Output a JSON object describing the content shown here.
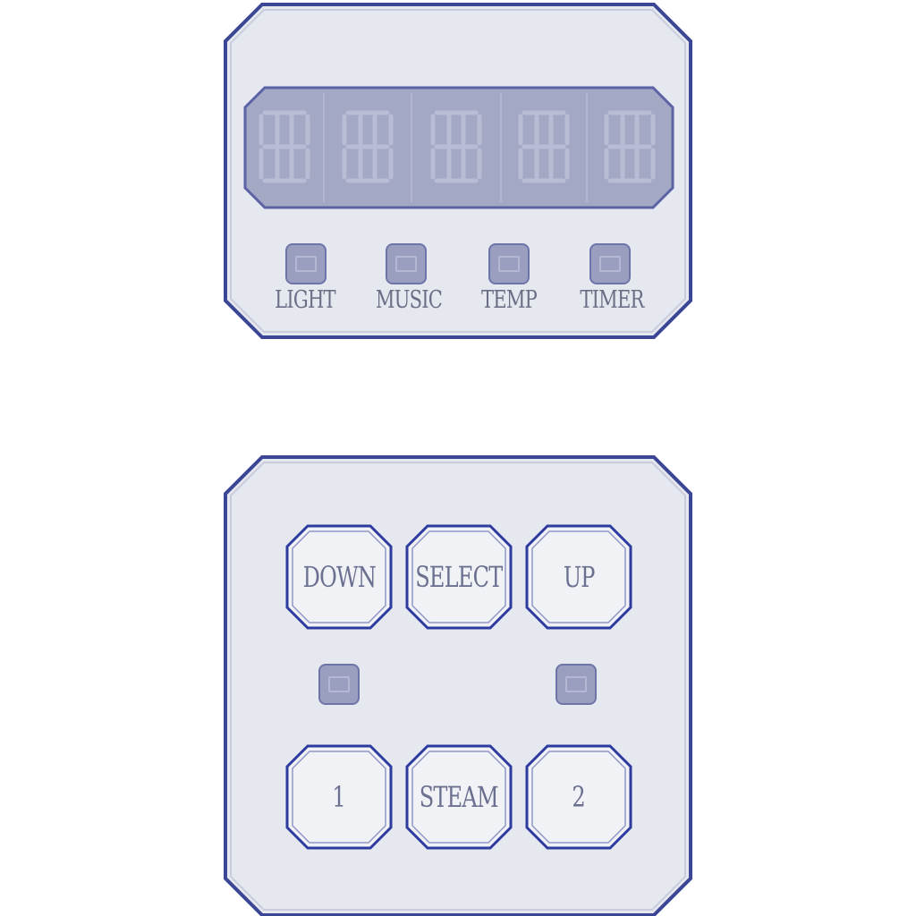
{
  "colors": {
    "panel_fill": "#e6e8f0",
    "panel_border": "#3b4695",
    "display_fill": "#a3a8c4",
    "display_border": "#5b63a5",
    "key_border": "#2d3a9e",
    "key_fill": "#f1f2f6",
    "label": "#6a6f86"
  },
  "indicators": [
    {
      "label": "LIGHT"
    },
    {
      "label": "MUSIC"
    },
    {
      "label": "TEMP"
    },
    {
      "label": "TIMER"
    }
  ],
  "keys": {
    "down": "DOWN",
    "select": "SELECT",
    "up": "UP",
    "one": "1",
    "steam": "STEAM",
    "two": "2"
  }
}
